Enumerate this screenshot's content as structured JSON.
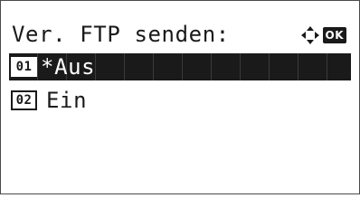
{
  "screen": {
    "title": "Ver. FTP senden:",
    "nav_icon": "dpad-arrows-icon",
    "ok_label": "OK"
  },
  "menu": {
    "items": [
      {
        "number": "01",
        "marker": "*",
        "label": "Aus",
        "selected": true
      },
      {
        "number": "02",
        "marker": "",
        "label": "Ein",
        "selected": false
      }
    ]
  },
  "colors": {
    "foreground": "#1a1a1a",
    "background": "#ffffff",
    "highlight": "#1a1a1a"
  }
}
